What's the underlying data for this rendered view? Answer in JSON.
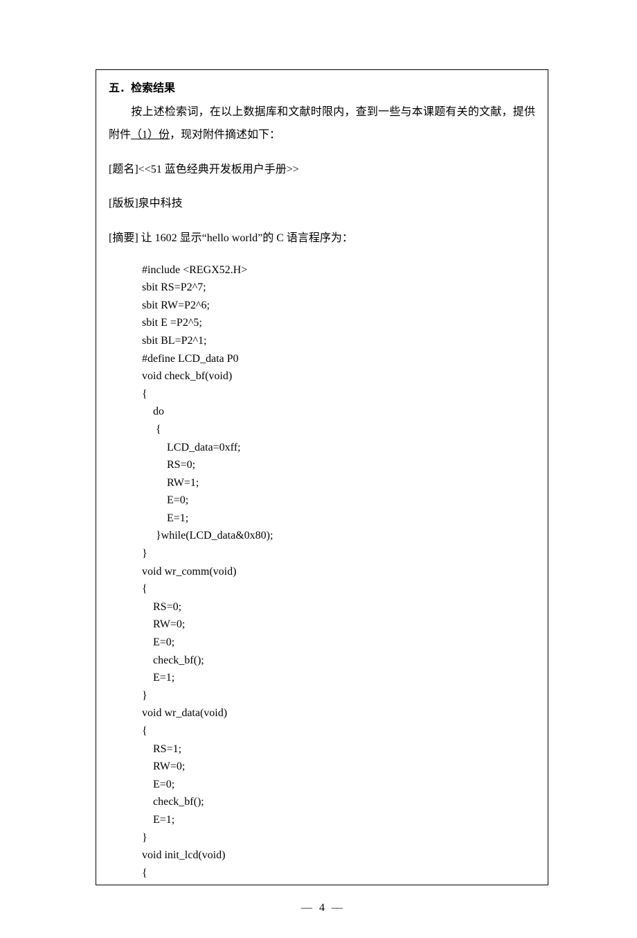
{
  "section": {
    "heading": "五．检索结果",
    "intro_pre": "按上述检索词，在以上数据库和文献时限内，查到一些与本课题有关的文献，提供附件",
    "intro_underline": "（1）份",
    "intro_post": "，现对附件摘述如下：",
    "titleLabel": "[题名]",
    "title": "<<51 蓝色经典开发板用户手册>>",
    "versionLabel": "[版板]",
    "version": "泉中科技",
    "abstractLabel": "[摘要]",
    "abstractText": " 让 1602 显示“hello world”的 C 语言程序为："
  },
  "code": "#include <REGX52.H>\nsbit RS=P2^7;\nsbit RW=P2^6;\nsbit E =P2^5;\nsbit BL=P2^1;\n#define LCD_data P0\nvoid check_bf(void)\n{\n    do\n     {\n         LCD_data=0xff;\n         RS=0;\n         RW=1;\n         E=0;\n         E=1;\n     }while(LCD_data&0x80);\n}\nvoid wr_comm(void)\n{\n    RS=0;\n    RW=0;\n    E=0;\n    check_bf();\n    E=1;\n}\nvoid wr_data(void)\n{\n    RS=1;\n    RW=0;\n    E=0;\n    check_bf();\n    E=1;\n}\nvoid init_lcd(void)\n{",
  "pageNumber": "4"
}
